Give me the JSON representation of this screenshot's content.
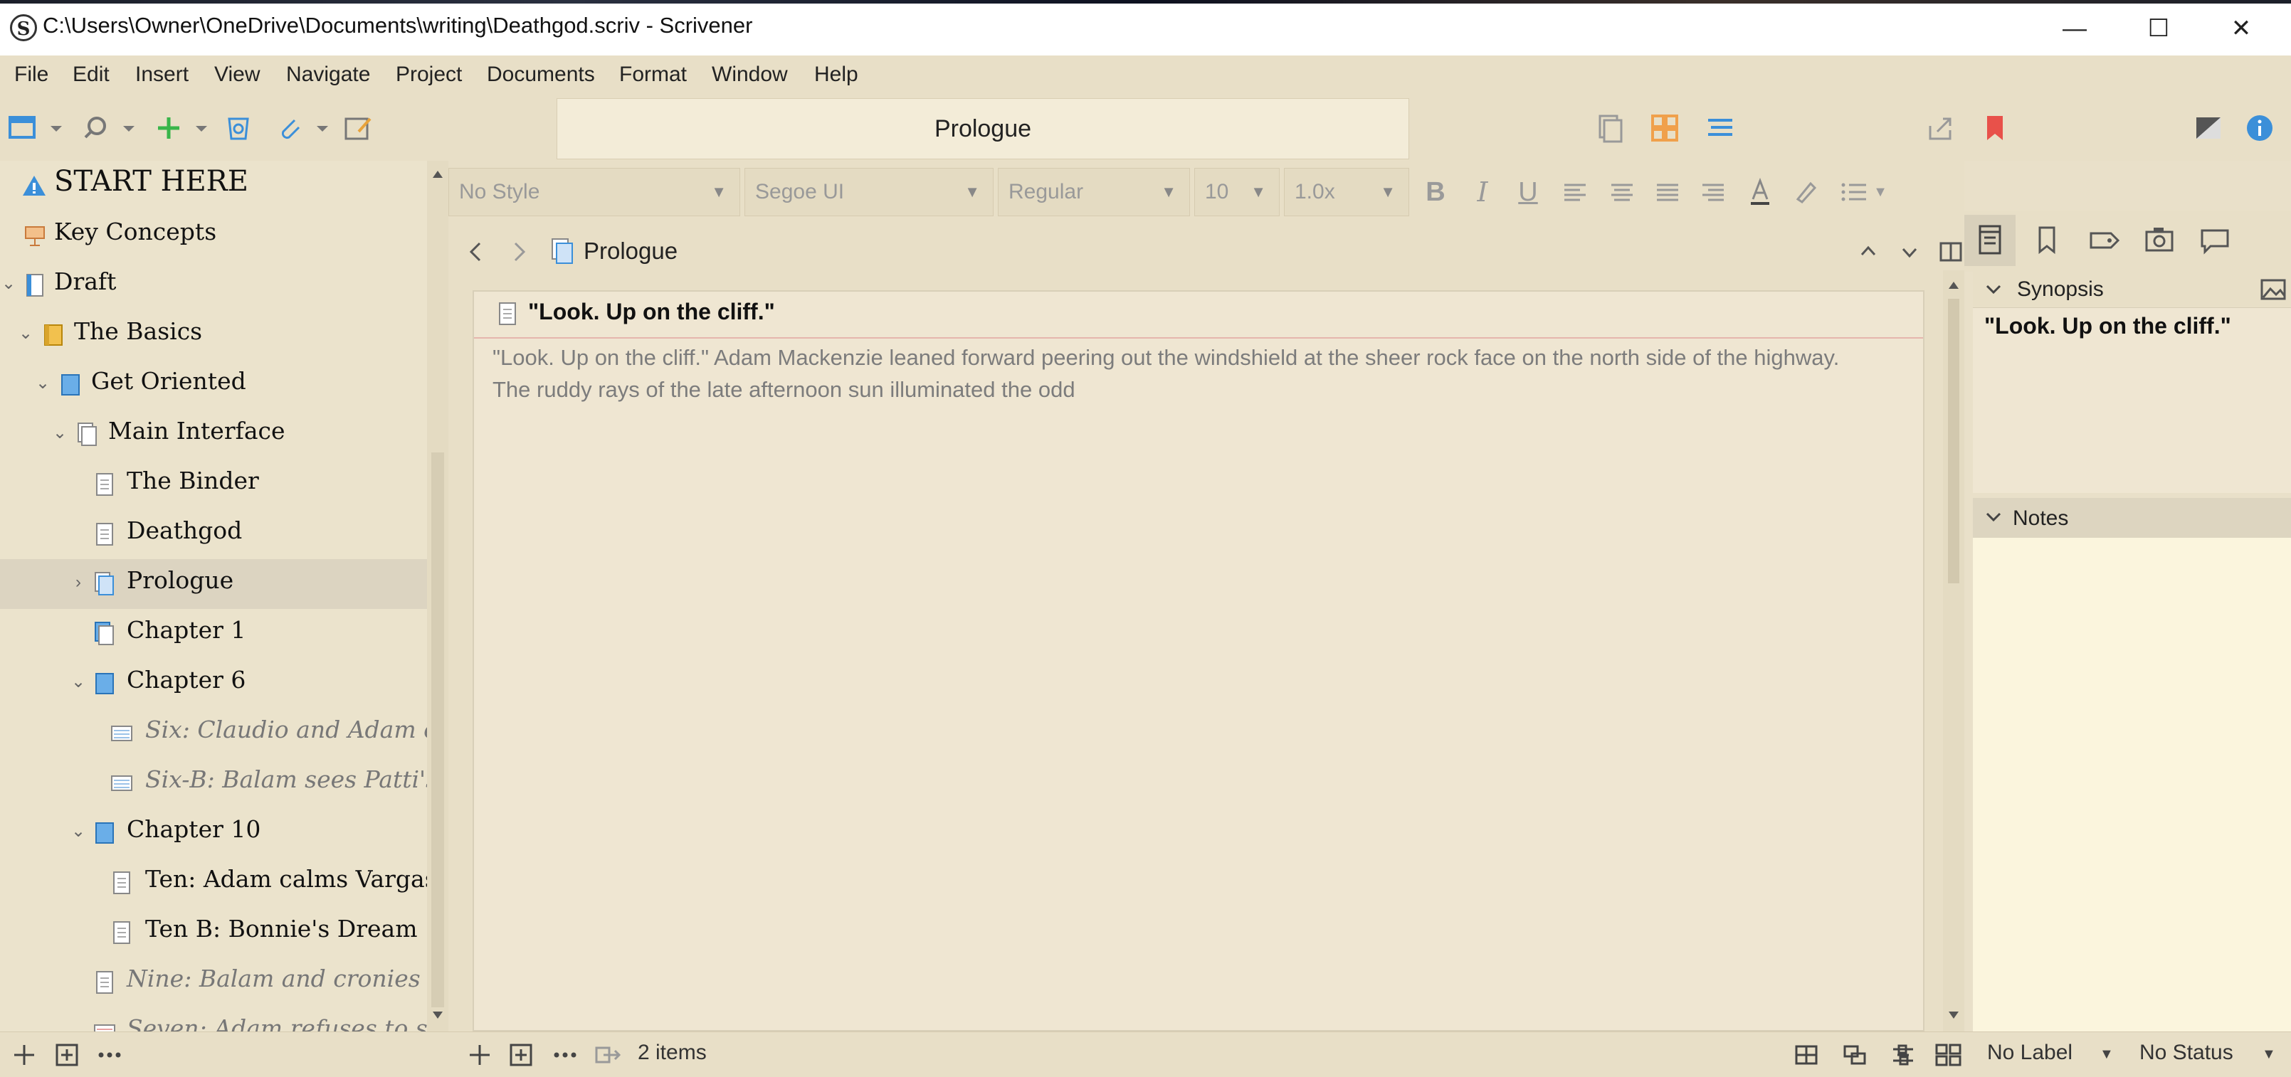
{
  "window": {
    "title": "C:\\Users\\Owner\\OneDrive\\Documents\\writing\\Deathgod.scriv - Scrivener",
    "app_icon_letter": "S",
    "minimize": "—",
    "maximize": "☐",
    "close": "✕"
  },
  "menu": [
    "File",
    "Edit",
    "Insert",
    "View",
    "Navigate",
    "Project",
    "Documents",
    "Format",
    "Window",
    "Help"
  ],
  "toolbar": {
    "document_title": "Prologue"
  },
  "binder": {
    "items": [
      {
        "label": "START HERE",
        "italic": false
      },
      {
        "label": "Key Concepts",
        "italic": false
      },
      {
        "label": "Draft",
        "italic": false
      },
      {
        "label": "The Basics",
        "italic": false
      },
      {
        "label": "Get Oriented",
        "italic": false
      },
      {
        "label": "Main Interface",
        "italic": false
      },
      {
        "label": "The Binder",
        "italic": false
      },
      {
        "label": "Deathgod",
        "italic": false
      },
      {
        "label": "Prologue",
        "italic": false
      },
      {
        "label": "Chapter 1",
        "italic": false
      },
      {
        "label": "Chapter 6",
        "italic": false
      },
      {
        "label": "Six: Claudio and Adam e...",
        "italic": true
      },
      {
        "label": "Six-B: Balam sees Patti's ...",
        "italic": true
      },
      {
        "label": "Chapter 10",
        "italic": false
      },
      {
        "label": "Ten: Adam calms Vargas",
        "italic": false
      },
      {
        "label": "Ten B: Bonnie's Dream",
        "italic": false
      },
      {
        "label": "Nine: Balam and cronies aw...",
        "italic": true
      },
      {
        "label": "Seven: Adam refuses to sign...",
        "italic": true
      }
    ]
  },
  "format_bar": {
    "style": "No Style",
    "font": "Segoe UI",
    "weight": "Regular",
    "size": "10",
    "line_spacing": "1.0x",
    "bold": "B",
    "italic": "I",
    "underline": "U"
  },
  "editor": {
    "header_title": "Prologue",
    "card_title": "\"Look. Up on the cliff.\"",
    "card_body": "\"Look. Up on the cliff.\" Adam Mackenzie leaned forward peering out the windshield at the sheer rock face on the north side of the highway. The ruddy rays of the late afternoon sun illuminated the odd"
  },
  "inspector": {
    "synopsis_label": "Synopsis",
    "synopsis_text": "\"Look. Up on the cliff.\"",
    "notes_label": "Notes"
  },
  "footer": {
    "items_count": "2 items",
    "label": "No Label",
    "status": "No Status"
  },
  "colors": {
    "background": "#e9e0c9",
    "accent_blue": "#3b8fd9",
    "bookmark_red": "#e8514a",
    "green_add": "#39b54a",
    "orange_grid": "#f0a04b"
  }
}
